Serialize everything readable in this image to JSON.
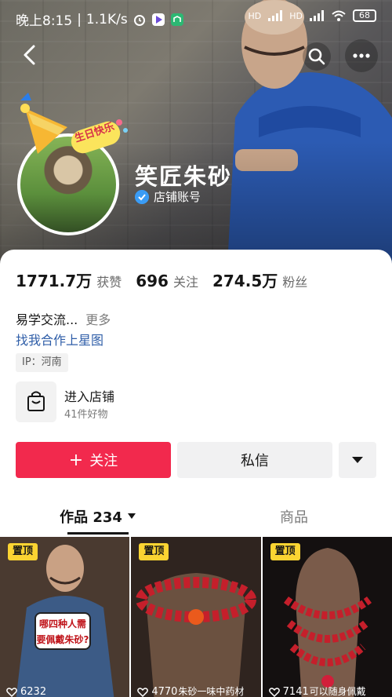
{
  "status_bar": {
    "time": "晚上8:15",
    "speed": "1.1K/s",
    "signal1": "HD",
    "signal2": "HD",
    "battery": "68"
  },
  "profile": {
    "name": "笑匠朱砂",
    "verified_label": "店铺账号",
    "birthday_badge": "生日快乐"
  },
  "stats": [
    {
      "num": "1771.7万",
      "label": "获赞"
    },
    {
      "num": "696",
      "label": "关注"
    },
    {
      "num": "274.5万",
      "label": "粉丝"
    }
  ],
  "bio": {
    "text": "易学交流...",
    "more": "更多",
    "link": "找我合作上星图",
    "ip": "IP：河南"
  },
  "shop": {
    "title": "进入店铺",
    "subtitle": "41件好物"
  },
  "actions": {
    "follow": "关注",
    "follow_plus": "+",
    "message": "私信"
  },
  "tabs": {
    "works": "作品 234",
    "goods": "商品"
  },
  "tiles": [
    {
      "pin": "置顶",
      "plays": "6232",
      "caption": "哪四种人需要佩戴朱砂?"
    },
    {
      "pin": "置顶",
      "plays": "4770",
      "caption": "朱砂一味中药材"
    },
    {
      "pin": "置顶",
      "plays": "7141",
      "caption": "可以随身佩戴"
    }
  ],
  "colors": {
    "accent": "#f2294d",
    "link": "#2f5ea8",
    "pin": "#fbd432",
    "verify": "#3a9cf5"
  }
}
